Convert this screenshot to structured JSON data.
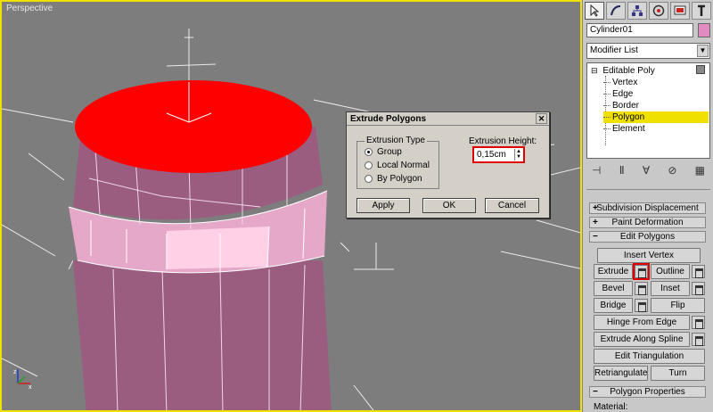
{
  "viewport": {
    "label": "Perspective"
  },
  "panel": {
    "tab_icons": [
      "cursor-icon",
      "curve-icon",
      "hierarchy-icon",
      "motion-icon",
      "display-icon",
      "utilities-icon"
    ],
    "object_name": "Cylinder01",
    "object_color": "#e08cc0",
    "modifier_list": "Modifier List",
    "stack": {
      "root": "Editable Poly",
      "items": [
        "Vertex",
        "Edge",
        "Border",
        "Polygon",
        "Element"
      ],
      "selected": "Polygon"
    },
    "rollouts": {
      "subdivision_displacement": "Subdivision Displacement",
      "paint_deformation": "Paint Deformation",
      "edit_polygons": "Edit Polygons",
      "polygon_properties": "Polygon Properties"
    },
    "buttons": {
      "insert_vertex": "Insert Vertex",
      "extrude": "Extrude",
      "outline": "Outline",
      "bevel": "Bevel",
      "inset": "Inset",
      "bridge": "Bridge",
      "flip": "Flip",
      "hinge_from_edge": "Hinge From Edge",
      "extrude_along_spline": "Extrude Along Spline",
      "edit_triangulation": "Edit Triangulation",
      "retriangulate": "Retriangulate",
      "turn": "Turn"
    },
    "material_label": "Material:"
  },
  "dialog": {
    "title": "Extrude Polygons",
    "extrusion_type_label": "Extrusion Type",
    "options": [
      "Group",
      "Local Normal",
      "By Polygon"
    ],
    "selected_option": "Group",
    "height_label": "Extrusion Height:",
    "height_value": "0,15cm",
    "apply": "Apply",
    "ok": "OK",
    "cancel": "Cancel"
  },
  "colors": {
    "accent_highlight": "#f0e000",
    "selected_polygon": "#ff0000",
    "mesh": "#b06890"
  }
}
